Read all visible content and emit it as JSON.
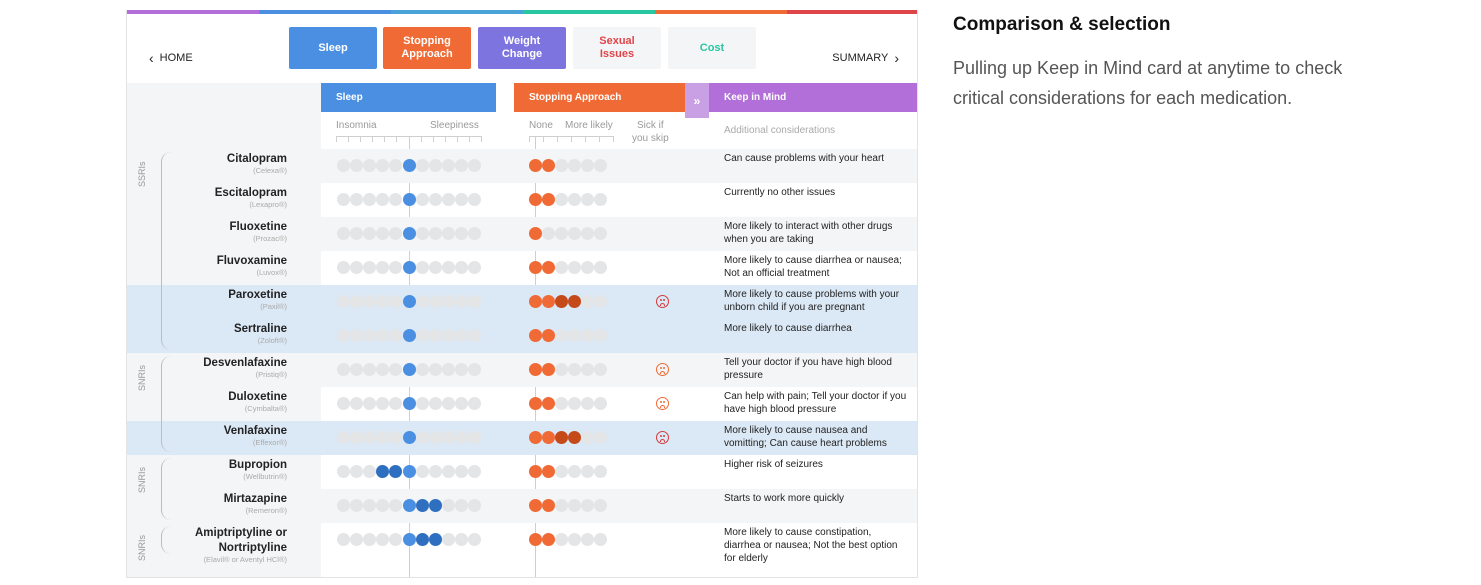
{
  "rainbow": [
    "#b26fd9",
    "#4a8fe2",
    "#4aa3d8",
    "#28c7a2",
    "#f06a35",
    "#e0454a"
  ],
  "nav": {
    "home_label": "HOME",
    "summary_label": "SUMMARY"
  },
  "tabs": [
    {
      "label": "Sleep",
      "bg": "#4a8fe2",
      "fg": "#ffffff"
    },
    {
      "label": "Stopping\nApproach",
      "bg": "#f06a35",
      "fg": "#ffffff"
    },
    {
      "label": "Weight\nChange",
      "bg": "#7d74e0",
      "fg": "#ffffff"
    },
    {
      "label": "Sexual\nIssues",
      "bg": "#f4f5f6",
      "fg": "#e0454a"
    },
    {
      "label": "Cost",
      "bg": "#f4f5f6",
      "fg": "#28c7a2"
    }
  ],
  "columns": {
    "sleep": {
      "title": "Sleep",
      "left_label": "Insomnia",
      "right_label": "Sleepiness",
      "color": "#4a8fe2"
    },
    "stopping": {
      "title": "Stopping Approach",
      "none_label": "None",
      "more_label": "More likely",
      "skip_label": "Sick if\nyou skip",
      "color": "#f06a35"
    },
    "keep": {
      "title": "Keep in Mind",
      "subtitle": "Additional considerations",
      "color": "#b26fd9"
    }
  },
  "groups": [
    {
      "label": "SSRIs",
      "first_row": 0,
      "last_row": 5
    },
    {
      "label": "SNRIs",
      "first_row": 6,
      "last_row": 8
    },
    {
      "label": "SNRIs",
      "first_row": 9,
      "last_row": 10
    },
    {
      "label": "SNRIs",
      "first_row": 11,
      "last_row": 11
    }
  ],
  "medications": [
    {
      "name": "Citalopram",
      "brand": "(Celexa®)",
      "sleep": [
        5
      ],
      "stop": 2,
      "sick": "",
      "note": "Can cause problems with your heart",
      "style": "alt"
    },
    {
      "name": "Escitalopram",
      "brand": "(Lexapro®)",
      "sleep": [
        5
      ],
      "stop": 2,
      "sick": "",
      "note": "Currently no other issues",
      "style": ""
    },
    {
      "name": "Fluoxetine",
      "brand": "(Prozac®)",
      "sleep": [
        5
      ],
      "stop": 1,
      "sick": "",
      "note": "More likely to interact with other drugs when you are taking",
      "style": "alt"
    },
    {
      "name": "Fluvoxamine",
      "brand": "(Luvox®)",
      "sleep": [
        5
      ],
      "stop": 2,
      "sick": "",
      "note": "More likely to cause diarrhea or nausea; Not an official treatment",
      "style": ""
    },
    {
      "name": "Paroxetine",
      "brand": "(Paxil®)",
      "sleep": [
        5
      ],
      "stop": 4,
      "sick": "red",
      "note": "More likely to cause problems with your unborn child if you are pregnant",
      "style": "hl"
    },
    {
      "name": "Sertraline",
      "brand": "(Zoloft®)",
      "sleep": [
        5
      ],
      "stop": 2,
      "sick": "",
      "note": "More likely to cause diarrhea",
      "style": "hl"
    },
    {
      "name": "Desvenlafaxine",
      "brand": "(Pristiq®)",
      "sleep": [
        5
      ],
      "stop": 2,
      "sick": "orange",
      "note": "Tell your doctor if you have high blood pressure",
      "style": "alt"
    },
    {
      "name": "Duloxetine",
      "brand": "(Cymbalta®)",
      "sleep": [
        5
      ],
      "stop": 2,
      "sick": "orange",
      "note": "Can help with pain; Tell your doctor if you have high blood pressure",
      "style": ""
    },
    {
      "name": "Venlafaxine",
      "brand": "(Effexor®)",
      "sleep": [
        5
      ],
      "stop": 4,
      "sick": "red",
      "note": "More likely to cause nausea and vomitting; Can cause heart problems",
      "style": "hl"
    },
    {
      "name": "Bupropion",
      "brand": "(Wellbutrin®)",
      "sleep": [
        3,
        4,
        5
      ],
      "stop": 2,
      "sick": "",
      "note": "Higher risk of seizures",
      "style": ""
    },
    {
      "name": "Mirtazapine",
      "brand": "(Remeron®)",
      "sleep": [
        5,
        6,
        7
      ],
      "stop": 2,
      "sick": "",
      "note": "Starts to work more quickly",
      "style": "alt"
    },
    {
      "name": "Amiptriptyline or\nNortriptyline",
      "brand": "(Elavil® or Aventyl HCl®)",
      "sleep": [
        5,
        6,
        7
      ],
      "stop": 2,
      "sick": "",
      "note": "More likely to cause constipation, diarrhea or nausea; Not the best option for elderly",
      "style": ""
    }
  ],
  "side": {
    "heading": "Comparison & selection",
    "body": "Pulling up Keep in Mind card at anytime to check critical considerations for each medication."
  }
}
